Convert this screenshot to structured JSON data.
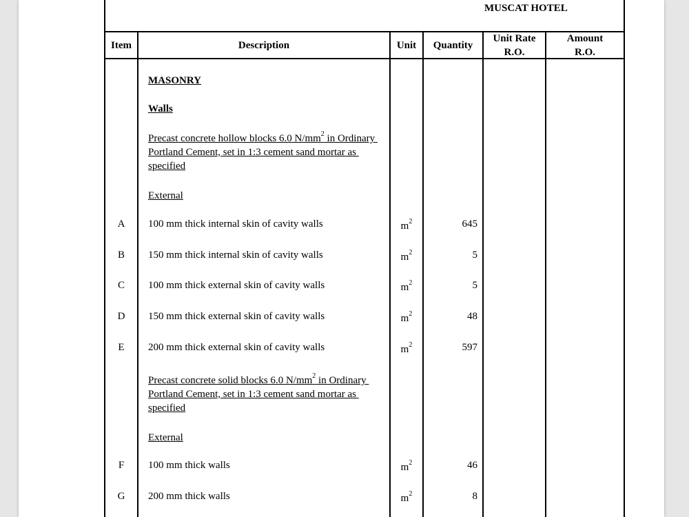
{
  "document": {
    "project_title": "MUSCAT HOTEL",
    "columns": {
      "item": "Item",
      "description": "Description",
      "unit": "Unit",
      "quantity": "Quantity",
      "unit_rate_line1": "Unit Rate",
      "unit_rate_line2": "R.O.",
      "amount_line1": "Amount",
      "amount_line2": "R.O."
    },
    "section": "MASONRY",
    "subsection": "Walls",
    "group1": {
      "spec_line1_pre": "Precast concrete hollow blocks 6.0 N/mm",
      "spec_line1_sup": "2",
      "spec_line1_post": " in Ordinary",
      "spec_line2": "Portland Cement, set in 1:3 cement sand mortar as",
      "spec_line3": "specified",
      "heading": "External",
      "items": [
        {
          "item": "A",
          "description": "100 mm thick internal skin of cavity walls",
          "unit": "m",
          "unit_sup": "2",
          "quantity": "645"
        },
        {
          "item": "B",
          "description": "150 mm thick internal skin of cavity walls",
          "unit": "m",
          "unit_sup": "2",
          "quantity": "5"
        },
        {
          "item": "C",
          "description": "100 mm thick external skin of cavity walls",
          "unit": "m",
          "unit_sup": "2",
          "quantity": "5"
        },
        {
          "item": "D",
          "description": "150 mm thick external skin of cavity walls",
          "unit": "m",
          "unit_sup": "2",
          "quantity": "48"
        },
        {
          "item": "E",
          "description": "200 mm thick external skin of cavity walls",
          "unit": "m",
          "unit_sup": "2",
          "quantity": "597"
        }
      ]
    },
    "group2": {
      "spec_line1_pre": "Precast concrete solid blocks 6.0 N/mm",
      "spec_line1_sup": "2",
      "spec_line1_post": " in Ordinary",
      "spec_line2": "Portland Cement, set in 1:3 cement sand mortar as",
      "spec_line3": "specified",
      "heading": "External",
      "items": [
        {
          "item": "F",
          "description": "100 mm thick walls",
          "unit": "m",
          "unit_sup": "2",
          "quantity": "46"
        },
        {
          "item": "G",
          "description": "200 mm thick walls",
          "unit": "m",
          "unit_sup": "2",
          "quantity": "8"
        }
      ]
    }
  }
}
